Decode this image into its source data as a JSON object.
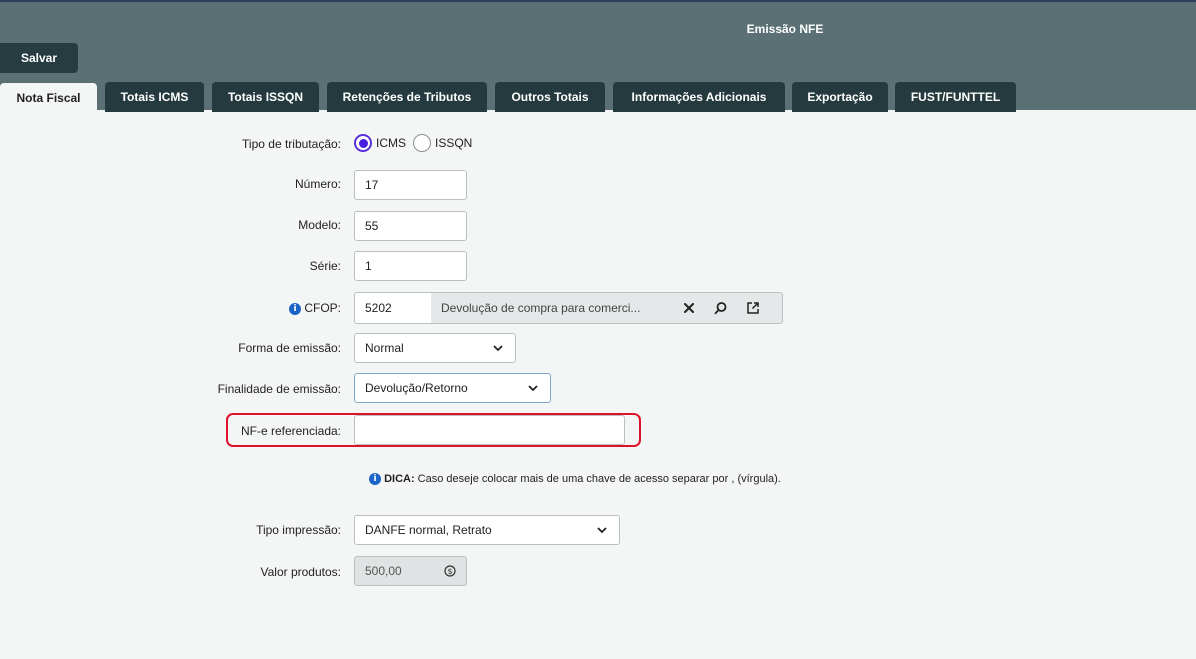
{
  "window": {
    "title": "Emissão NFE"
  },
  "toolbar": {
    "save_label": "Salvar"
  },
  "tabs": [
    {
      "label": "Nota Fiscal",
      "active": true
    },
    {
      "label": "Totais ICMS"
    },
    {
      "label": "Totais ISSQN"
    },
    {
      "label": "Retenções de Tributos"
    },
    {
      "label": "Outros Totais"
    },
    {
      "label": "Informações Adicionais"
    },
    {
      "label": "Exportação"
    },
    {
      "label": "FUST/FUNTTEL"
    }
  ],
  "form": {
    "tipo_tributacao": {
      "label": "Tipo de tributação:",
      "options": [
        "ICMS",
        "ISSQN"
      ],
      "selected": "ICMS"
    },
    "numero": {
      "label": "Número:",
      "value": "17"
    },
    "modelo": {
      "label": "Modelo:",
      "value": "55"
    },
    "serie": {
      "label": "Série:",
      "value": "1"
    },
    "cfop": {
      "label": "CFOP:",
      "code": "5202",
      "description": "Devolução de compra para comerci..."
    },
    "forma_emissao": {
      "label": "Forma de emissão:",
      "value": "Normal"
    },
    "finalidade_emissao": {
      "label": "Finalidade de emissão:",
      "value": "Devolução/Retorno"
    },
    "nfe_referenciada": {
      "label": "NF-e referenciada:",
      "value": ""
    },
    "dica": {
      "prefix": "DICA:",
      "text": " Caso deseje colocar mais de uma chave de acesso separar por , (vírgula)."
    },
    "tipo_impressao": {
      "label": "Tipo impressão:",
      "value": "DANFE normal, Retrato"
    },
    "valor_produtos": {
      "label": "Valor produtos:",
      "value": "500,00"
    }
  },
  "colors": {
    "header": "#5a7074",
    "tab": "#243a3e",
    "highlight": "#e0122b",
    "radio": "#4a1ee0",
    "info": "#1b64c8"
  }
}
